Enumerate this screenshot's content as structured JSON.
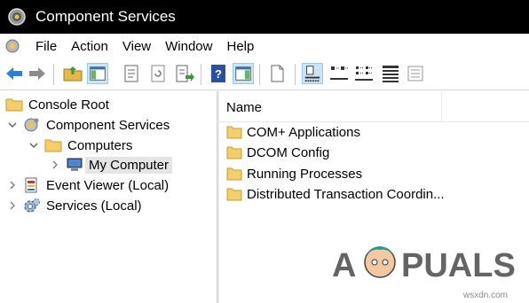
{
  "window": {
    "title": "Component Services"
  },
  "menu": [
    "File",
    "Action",
    "View",
    "Window",
    "Help"
  ],
  "toolbar": {
    "icons": [
      "back-arrow-icon",
      "forward-arrow-icon",
      "up-folder-icon",
      "show-hide-tree-icon",
      "properties-icon",
      "refresh-icon",
      "export-list-icon",
      "help-icon",
      "show-hide-action-pane-icon",
      "new-window-icon",
      "large-icons-view-icon",
      "small-icons-view-icon",
      "list-view-icon",
      "detail-view-icon",
      "properties-list-icon"
    ]
  },
  "tree": {
    "console_root": "Console Root",
    "component_services": "Component Services",
    "computers": "Computers",
    "my_computer": "My Computer",
    "event_viewer": "Event Viewer (Local)",
    "services": "Services (Local)"
  },
  "list": {
    "header": "Name",
    "items": [
      "COM+ Applications",
      "DCOM Config",
      "Running Processes",
      "Distributed Transaction Coordin..."
    ]
  },
  "watermark": {
    "logo": "APPUALS",
    "site": "wsxdn.com"
  }
}
